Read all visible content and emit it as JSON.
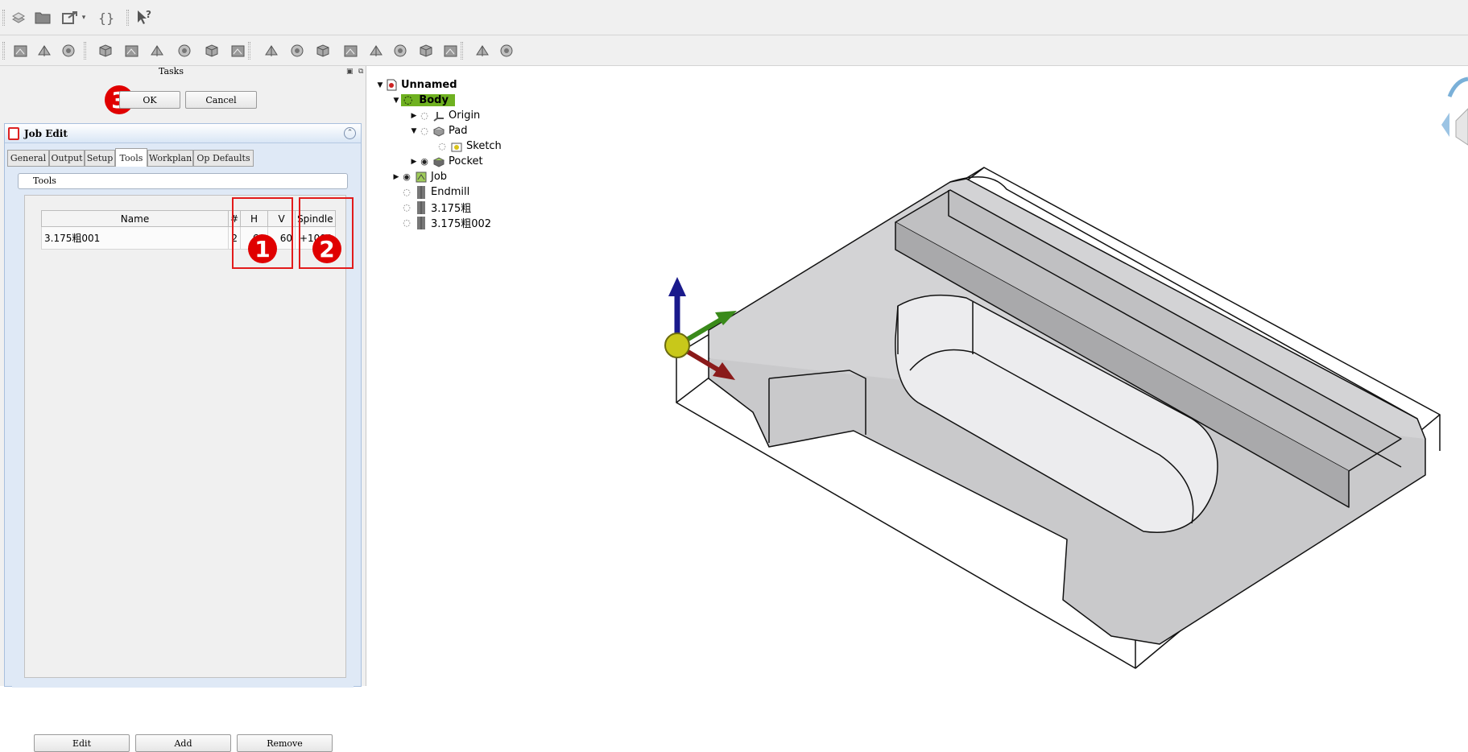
{
  "toolbar1": {
    "icons": [
      "workbench-icon",
      "open-folder-icon",
      "export-icon",
      "macro-braces-icon",
      "whats-this-icon"
    ],
    "macro_glyph": "{}"
  },
  "toolbar2": {
    "icons": [
      "job-icon",
      "post-process-icon",
      "sanity-check-icon",
      "profile-icon",
      "pocket-icon",
      "adaptive-icon",
      "face-icon",
      "drill-icon",
      "helix-icon",
      "engrave-icon",
      "deburr-icon",
      "vcarve-icon",
      "slot-icon",
      "surface-icon",
      "waterline-icon",
      "tool-library-icon",
      "tool-bit-icon",
      "simulate-icon",
      "stock-icon"
    ]
  },
  "tasks": {
    "title": "Tasks",
    "ok_label": "OK",
    "cancel_label": "Cancel"
  },
  "job_edit": {
    "title": "Job Edit",
    "tabs": [
      "General",
      "Output",
      "Setup",
      "Tools",
      "Workplan",
      "Op Defaults"
    ],
    "active_tab": "Tools",
    "group_label": "Tools",
    "columns": {
      "name": "Name",
      "num": "#",
      "h": "H",
      "v": "V",
      "spindle": "Spindle"
    },
    "rows": [
      {
        "name": "3.175粗001",
        "num": "2",
        "h": "60",
        "v": "60",
        "spindle": "+1000"
      }
    ],
    "buttons": {
      "edit": "Edit",
      "add": "Add",
      "remove": "Remove"
    }
  },
  "markers": {
    "one": "1",
    "two": "2",
    "three": "3"
  },
  "annotation_color": "#e21b1b",
  "tree": {
    "root": "Unnamed",
    "body": "Body",
    "origin": "Origin",
    "pad": "Pad",
    "sketch": "Sketch",
    "pocket": "Pocket",
    "job": "Job",
    "endmill": "Endmill",
    "tool1": "3.175粗",
    "tool2": "3.175粗002"
  },
  "colors": {
    "body_highlight": "#6fb120",
    "panel_bg": "#dfe9f6",
    "model_fill": "#d3d3d5",
    "axis_z": "#1a1a8c",
    "axis_y": "#3a8a1a",
    "axis_x": "#8a1a1a"
  }
}
